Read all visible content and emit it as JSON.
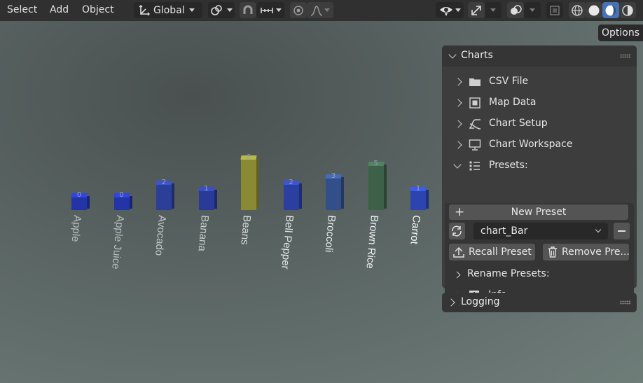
{
  "menu": {
    "select": "Select",
    "add": "Add",
    "object": "Object"
  },
  "header": {
    "orientation": "Global",
    "options": "Options"
  },
  "colors": {
    "header_bg": "#303030",
    "panel_bg": "#3d3d3d",
    "accent": "#4772b3"
  },
  "charts_panel": {
    "title": "Charts",
    "sections": [
      {
        "label": "CSV File",
        "icon": "folder-icon"
      },
      {
        "label": "Map Data",
        "icon": "map-data-icon"
      },
      {
        "label": "Chart Setup",
        "icon": "chart-curve-icon"
      },
      {
        "label": "Chart Workspace",
        "icon": "monitor-icon"
      },
      {
        "label": "Presets:",
        "icon": "list-icon"
      }
    ],
    "presets": {
      "new_preset": "New Preset",
      "selected": "chart_Bar",
      "recall": "Recall Preset",
      "remove": "Remove Pre...",
      "rename": "Rename Presets:",
      "info": "Info"
    }
  },
  "logging_panel": {
    "title": "Logging"
  },
  "chart_data": {
    "type": "bar",
    "categories": [
      "Apple",
      "Apple Juice",
      "Avocado",
      "Banana",
      "Beans",
      "Bell Pepper",
      "Broccoli",
      "Brown Rice",
      "Carrot"
    ],
    "values": [
      0,
      0,
      2,
      1,
      6,
      2,
      3,
      5,
      1
    ],
    "bar_colors": [
      "#2334a6",
      "#2334a6",
      "#2b3f98",
      "#2a3a98",
      "#8a8a35",
      "#2b3fa0",
      "#334f8a",
      "#3d6048",
      "#2c44b0"
    ],
    "label_colors": [
      "#b7bcbe",
      "#b7bcbe",
      "#c2c7c8",
      "#c8cdcd",
      "#d8dcdc",
      "#e2e6e6",
      "#e8ecec",
      "#eff2f2",
      "#f6f8f8"
    ],
    "ylim": [
      0,
      6
    ]
  }
}
